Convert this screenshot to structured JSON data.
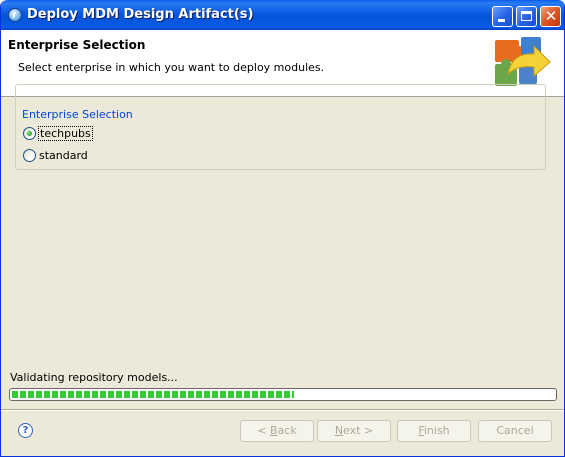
{
  "window": {
    "title": "Deploy MDM Design Artifact(s)",
    "icon": "eclipse-app-icon",
    "controls": {
      "minimize": "minimize-icon",
      "maximize": "maximize-icon",
      "close": "close-icon"
    }
  },
  "banner": {
    "title": "Enterprise Selection",
    "description": "Select enterprise in which you want to deploy modules."
  },
  "group": {
    "legend": "Enterprise Selection",
    "options": [
      {
        "label": "techpubs",
        "checked": true
      },
      {
        "label": "standard",
        "checked": false
      }
    ]
  },
  "status": {
    "text": "Validating repository models...",
    "progress_fraction": 0.52
  },
  "footer": {
    "help_icon": "help-icon",
    "help_glyph": "?",
    "back": {
      "prefix": "< ",
      "mnemonic": "B",
      "rest": "ack"
    },
    "next": {
      "mnemonic": "N",
      "rest": "ext >"
    },
    "finish": {
      "mnemonic": "F",
      "rest": "inish"
    },
    "cancel": "Cancel"
  },
  "colors": {
    "titlebar": "#0a5de8",
    "dialog_bg": "#ece9d8",
    "legend_text": "#0046d5",
    "progress_green": "#2fcf2f",
    "disabled_text": "#aca899"
  }
}
